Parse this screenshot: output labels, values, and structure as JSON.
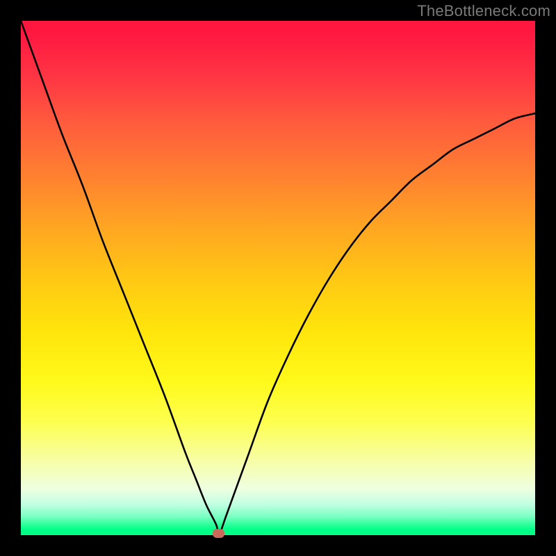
{
  "watermark": "TheBottleneck.com",
  "colors": {
    "background": "#000000",
    "curve": "#000000",
    "marker": "#c96a5b"
  },
  "chart_data": {
    "type": "line",
    "title": "",
    "xlabel": "",
    "ylabel": "",
    "xlim": [
      0,
      100
    ],
    "ylim": [
      0,
      100
    ],
    "grid": false,
    "legend": false,
    "series": [
      {
        "name": "bottleneck-curve",
        "x": [
          0,
          4,
          8,
          12,
          16,
          20,
          24,
          28,
          32,
          34,
          36,
          38,
          38.5,
          40,
          44,
          48,
          52,
          56,
          60,
          64,
          68,
          72,
          76,
          80,
          84,
          88,
          92,
          96,
          100
        ],
        "values": [
          100,
          89,
          78,
          68,
          57,
          47,
          37,
          27,
          16,
          11,
          6,
          2,
          0,
          4,
          15,
          26,
          35,
          43,
          50,
          56,
          61,
          65,
          69,
          72,
          75,
          77,
          79,
          81,
          82
        ]
      }
    ],
    "marker": {
      "x": 38.5,
      "y": 0
    },
    "background_gradient": {
      "0": "#ff173f",
      "50": "#ffc714",
      "78": "#fdff4f",
      "100": "#00ff85"
    }
  }
}
